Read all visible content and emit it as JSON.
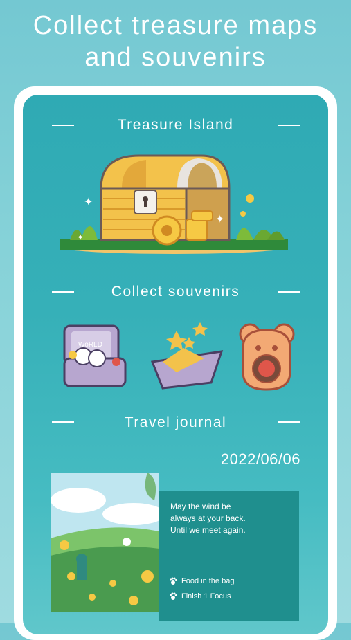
{
  "headline": {
    "line1": "Collect treasure maps",
    "line2": "and souvenirs"
  },
  "sections": {
    "treasure": {
      "title": "Treasure Island"
    },
    "souvenirs": {
      "title": "Collect souvenirs"
    },
    "journal": {
      "title": "Travel journal"
    }
  },
  "souvenir_items": {
    "suitcase": {
      "icon": "suitcase-icon",
      "label": "WoRLD"
    },
    "paper_boat": {
      "icon": "paper-boat-icon"
    },
    "bear_cookie": {
      "icon": "bear-cookie-icon"
    }
  },
  "journal": {
    "date": "2022/06/06",
    "quote_line1": "May the wind be",
    "quote_line2": "always at your back.",
    "quote_line3": "Until we meet again.",
    "tasks": [
      {
        "icon": "paw-icon",
        "label": "Food in the bag"
      },
      {
        "icon": "paw-icon",
        "label": "Finish 1 Focus"
      }
    ]
  },
  "colors": {
    "background": "#80cdd5",
    "screen": "#36b0b8",
    "panel": "#1f8f8e",
    "gold": "#f1c04a"
  }
}
